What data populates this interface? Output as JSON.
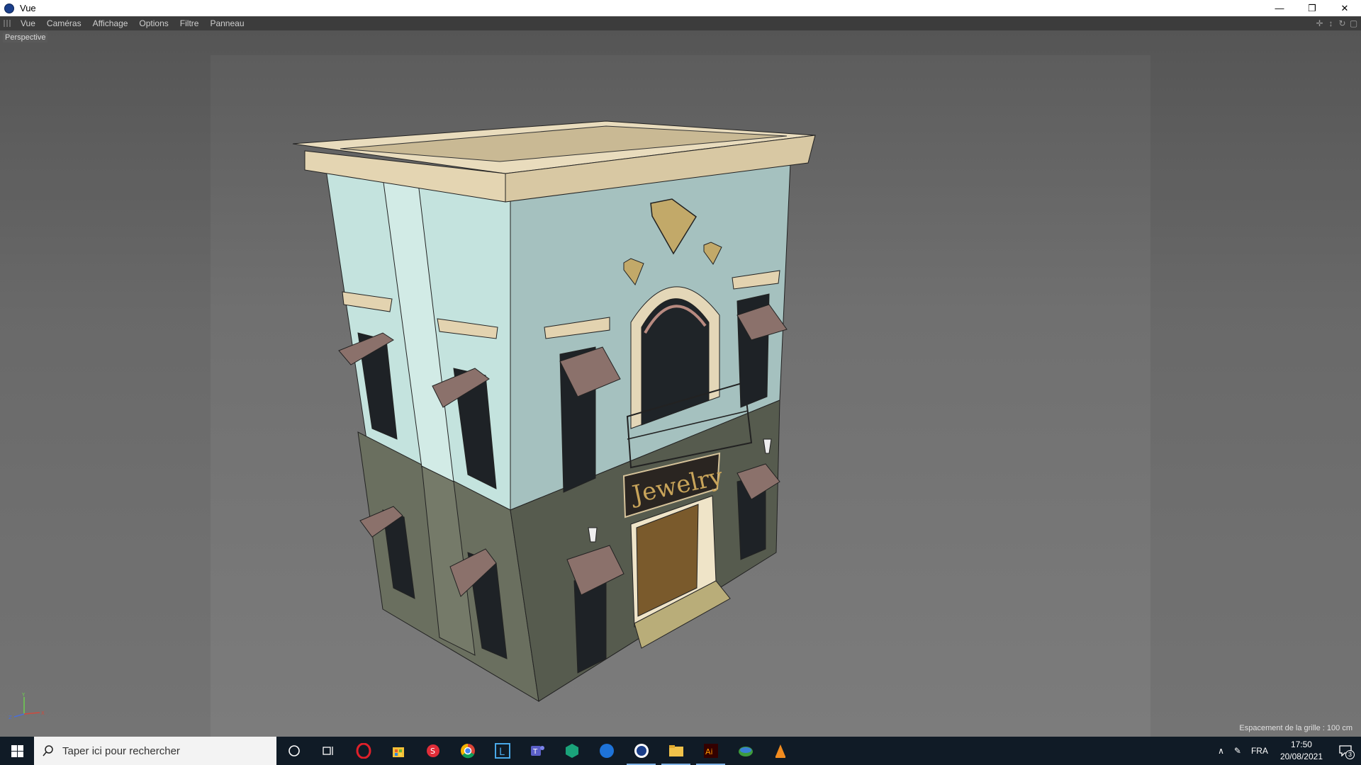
{
  "window": {
    "title": "Vue",
    "controls": [
      "minimize",
      "restore",
      "close"
    ]
  },
  "menubar": {
    "items": [
      "Vue",
      "Caméras",
      "Affichage",
      "Options",
      "Filtre",
      "Panneau"
    ]
  },
  "viewport": {
    "camera_label": "Perspective",
    "grid_spacing": "Espacement de la grille : 100 cm",
    "sign_text": "Jewelry",
    "axis_labels": {
      "x": "X",
      "y": "Y",
      "z": "Z"
    }
  },
  "taskbar": {
    "search_placeholder": "Taper ici pour rechercher",
    "apps": [
      "cortana-icon",
      "task-view-icon",
      "opera-icon",
      "store-icon",
      "sketchup-icon",
      "chrome-icon",
      "lightroom-icon",
      "teams-icon",
      "app-green-icon",
      "app-blue-icon",
      "cinema4d-icon",
      "explorer-icon",
      "illustrator-icon",
      "earth-icon",
      "vlc-icon"
    ],
    "language": "FRA",
    "time": "17:50",
    "date": "20/08/2021",
    "notifications": "3"
  }
}
